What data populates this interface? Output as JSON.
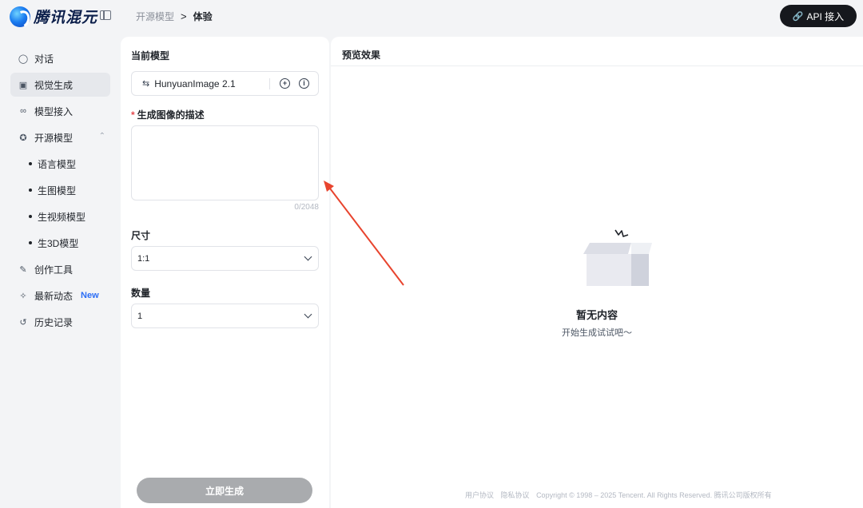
{
  "app": {
    "brand_name": "腾讯混元"
  },
  "breadcrumb": {
    "parent": "开源模型",
    "separator": ">",
    "current": "体验"
  },
  "header": {
    "api_button_label": "API 接入"
  },
  "sidebar": {
    "items": [
      {
        "label": "对话",
        "icon": "chat-icon"
      },
      {
        "label": "视觉生成",
        "icon": "image-icon",
        "active": true
      },
      {
        "label": "模型接入",
        "icon": "plug-icon"
      },
      {
        "label": "开源模型",
        "icon": "open-source-icon",
        "expanded": true
      },
      {
        "label": "创作工具",
        "icon": "brush-icon"
      },
      {
        "label": "最新动态",
        "icon": "sparkle-icon",
        "badge": "New"
      },
      {
        "label": "历史记录",
        "icon": "history-icon"
      }
    ],
    "sub_items": [
      "语言模型",
      "生图模型",
      "生视频模型",
      "生3D模型"
    ]
  },
  "form": {
    "current_model_label": "当前模型",
    "model_name": "HunyuanImage 2.1",
    "description_label": "生成图像的描述",
    "description_value": "",
    "char_count": "0/2048",
    "size_label": "尺寸",
    "size_value": "1:1",
    "quantity_label": "数量",
    "quantity_value": "1",
    "generate_button": "立即生成"
  },
  "preview": {
    "title": "预览效果",
    "empty_title": "暂无内容",
    "empty_subtitle": "开始生成试试吧～"
  },
  "footer": {
    "user_agreement": "用户协议",
    "privacy": "隐私协议",
    "copyright": "Copyright © 1998 – 2025 Tencent. All Rights Reserved. 腾讯公司版权所有"
  },
  "colors": {
    "accent_new": "#2b6df5",
    "required_star": "#e5484d",
    "api_button_bg": "#16181d",
    "generate_button_bg": "#a9abae",
    "annotation_arrow": "#e8442e"
  }
}
